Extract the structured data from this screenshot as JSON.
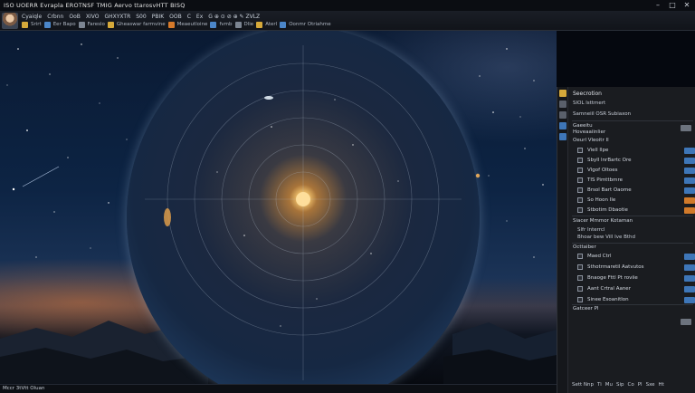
{
  "window": {
    "title": "ISO UOERR Evrapla EROTNSF TMIG Aervo ttarosvHTT BISQ",
    "controls": [
      "–",
      "□",
      "✕"
    ]
  },
  "toolbar": {
    "row1": [
      "Cyaiqle",
      "Crbnn",
      "OoB",
      "XIVO",
      "GHXYXTR",
      "S00",
      "PBIK",
      "OOB",
      "C",
      "Ex"
    ],
    "row1_tail": "G ⊕ ⊙ ⊘ ⊕ ✎ ZVLZ",
    "row2": [
      "Srirt",
      "Eer Bapo",
      "Fareslo",
      "Gheaswar farmvine",
      "Meaeutloine",
      "fvmb",
      "Dlie",
      "Aterl",
      "Oonmr Otriahme"
    ]
  },
  "status": {
    "text": "Mccr 3tVtt Oluan"
  },
  "panel": {
    "header": "Seecrotion",
    "line1": "SIOL lsttmert",
    "line2": "Samneiil OSR Subiaxon",
    "sub1": "Gaeeitu",
    "sub2": "Hoveaaiinlier",
    "sub3": "Oeurl Vleoitr Il",
    "group1": [
      {
        "label": "Viell Ilpe",
        "toggle": "blue"
      },
      {
        "label": "Sbyll lnrBartc Ore",
        "toggle": "blue"
      },
      {
        "label": "Vlgof Oltoes",
        "toggle": "blue"
      },
      {
        "label": "TIS Pimttbmre",
        "toggle": "blue"
      },
      {
        "label": "Brsol Bart Oaome",
        "toggle": "blue"
      },
      {
        "label": "So Hoon Ile",
        "toggle": "orange"
      },
      {
        "label": "Stbotim Dbaotie",
        "toggle": "orange"
      }
    ],
    "section2_title": "Siacer Mmmor Kotaman",
    "section2_lines": [
      "Slfr Interrcl",
      "Bhoar bew Vill Ive Bthd"
    ],
    "section3_title": "Octtaiber",
    "group2": [
      {
        "label": "Maed Ctrl",
        "toggle": "blue"
      },
      {
        "label": "Sthotrmaretil Aatvutos",
        "toggle": "blue"
      },
      {
        "label": "Bnaoge Fttl Pt roviie",
        "toggle": "blue"
      },
      {
        "label": "Aant Crtral Aaner",
        "toggle": "blue"
      },
      {
        "label": "Sinee Esoanitlon",
        "toggle": "blue"
      }
    ],
    "section4_title": "Gatceer Pl",
    "footer": [
      "Sett Nnp",
      "Ti",
      "Mu",
      "Sip",
      "Co",
      "Pl",
      "Sxe",
      "Ht"
    ],
    "colors": {
      "toggle_blue": "#3e76b8",
      "toggle_orange": "#d17a2a",
      "accent_gold": "#d6a93a"
    }
  }
}
